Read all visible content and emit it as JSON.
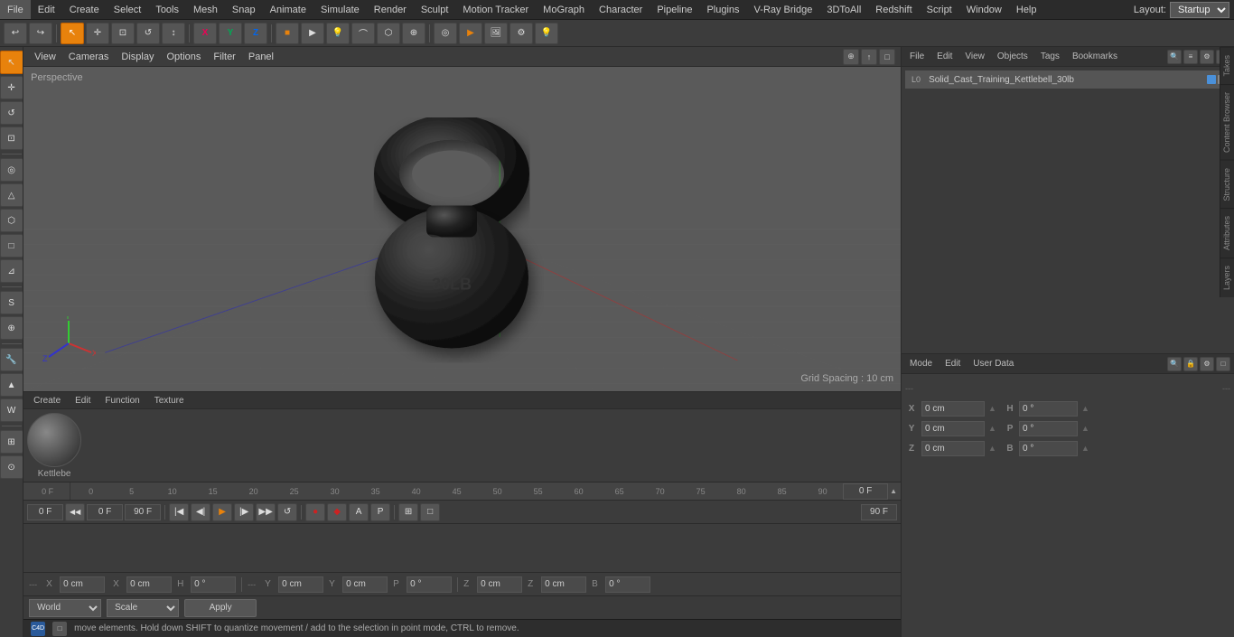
{
  "menubar": {
    "items": [
      "File",
      "Edit",
      "Create",
      "Select",
      "Tools",
      "Mesh",
      "Snap",
      "Animate",
      "Simulate",
      "Render",
      "Sculpt",
      "Motion Tracker",
      "MoGraph",
      "Character",
      "Pipeline",
      "Plugins",
      "V-Ray Bridge",
      "3DToAll",
      "Redshift",
      "Script",
      "Window",
      "Help"
    ],
    "layout_label": "Layout:",
    "layout_value": "Startup"
  },
  "toolbar": {
    "undo_icon": "↩",
    "redo_icon": "↪",
    "mode_icons": [
      "↖",
      "+",
      "□",
      "↺",
      "↑"
    ],
    "axis_icons": [
      "X",
      "Y",
      "Z"
    ],
    "primitive_icons": [
      "■",
      "▶",
      "⬡",
      "⬤",
      "↺",
      "⊕"
    ],
    "camera_icons": [
      "🎥",
      "📷",
      "◉"
    ]
  },
  "viewport": {
    "perspective_label": "Perspective",
    "grid_spacing": "Grid Spacing : 10 cm",
    "header_items": [
      "View",
      "Cameras",
      "Display",
      "Options",
      "Filter",
      "Panel"
    ],
    "corner_icons": [
      "⊕",
      "↑",
      "□"
    ]
  },
  "left_toolbar": {
    "tools": [
      "↖",
      "↕",
      "↺",
      "⊕",
      "◎",
      "△",
      "⬡",
      "□",
      "⊿",
      "S",
      "⊕",
      "🔧"
    ]
  },
  "timeline": {
    "ruler_marks": [
      "0",
      "5",
      "10",
      "15",
      "20",
      "25",
      "30",
      "35",
      "40",
      "45",
      "50",
      "55",
      "60",
      "65",
      "70",
      "75",
      "80",
      "85",
      "90"
    ],
    "current_frame_label": "0 F",
    "start_frame": "0 F",
    "end_frame": "90 F",
    "end_frame2": "90 F",
    "frame_input": "0 F",
    "control_icons": [
      "|◀",
      "◀|",
      "▶",
      "|▶",
      "▶▶",
      "↺"
    ],
    "extra_icons": [
      "⊕",
      "⊡",
      "↺",
      "P",
      "⊞",
      "□"
    ]
  },
  "right_panel": {
    "top_toolbar": {
      "file_btn": "File",
      "edit_btn": "Edit",
      "view_btn": "View",
      "objects_btn": "Objects",
      "tags_btn": "Tags",
      "bookmarks_btn": "Bookmarks"
    },
    "object": {
      "name": "Solid_Cast_Training_Kettlebell_30lb",
      "icon": "L0",
      "dot_color": "#4a90d9"
    },
    "attr_toolbar": {
      "mode_btn": "Mode",
      "edit_btn": "Edit",
      "user_data_btn": "User Data"
    },
    "attr_sections": {
      "x_label": "X",
      "y_label": "Y",
      "z_label": "Z",
      "x_val": "0 cm",
      "y_val": "0 cm",
      "z_val": "0 cm",
      "h_label": "H",
      "p_label": "P",
      "b_label": "B",
      "h_val": "0 °",
      "p_val": "0 °",
      "b_val": "0 °",
      "x2_val": "0 cm",
      "y2_val": "0 cm",
      "z2_val": "0 cm",
      "dashes": "---"
    }
  },
  "coord_bar": {
    "x_label": "X",
    "y_label": "Y",
    "z_label": "Z",
    "x2_label": "X",
    "y2_label": "Y",
    "z2_label": "Z",
    "x_val": "0 cm",
    "y_val": "0 cm",
    "z_val": "0 cm",
    "x2_val": "0 cm",
    "y2_val": "0 cm",
    "z2_val": "0 cm",
    "h_val": "0 °",
    "p_val": "0 °",
    "b_val": "0 °"
  },
  "wsa_bar": {
    "world_label": "World",
    "scale_label": "Scale",
    "apply_label": "Apply"
  },
  "status_bar": {
    "text": "move elements. Hold down SHIFT to quantize movement / add to the selection in point mode, CTRL to remove.",
    "icons": [
      "C4D",
      "□"
    ]
  },
  "material_panel": {
    "toolbar_items": [
      "Create",
      "Edit",
      "Function",
      "Texture"
    ],
    "material_name": "Kettlebe",
    "ball_gradient": "radial-gradient(circle at 35% 35%, #888, #222)"
  },
  "right_tabs": [
    "Takes",
    "Content Browser",
    "Structure",
    "Attributes",
    "Layers"
  ]
}
